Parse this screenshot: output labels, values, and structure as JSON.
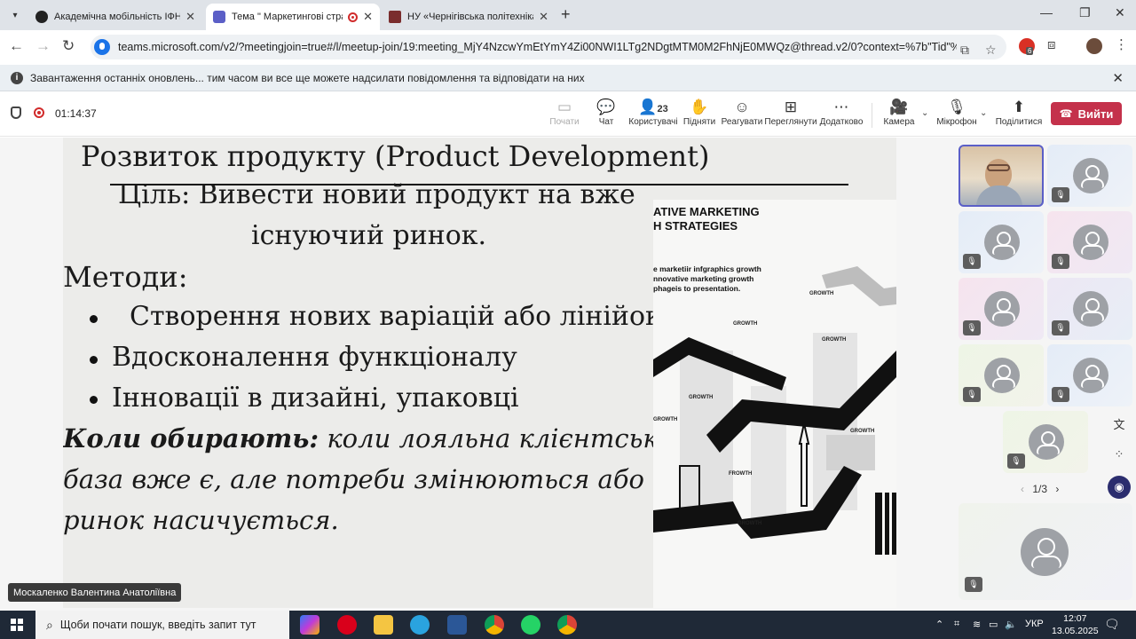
{
  "browser": {
    "tabs": [
      {
        "title": "Академічна мобільність ІФНТУ",
        "favicon": "github-icon",
        "active": false
      },
      {
        "title": "Тема \" Маркетингові страт",
        "favicon": "teams-icon",
        "active": true,
        "recording": true
      },
      {
        "title": "НУ «Чернігівська політехніка»",
        "favicon": "university-icon",
        "active": false
      }
    ],
    "new_tab": "+",
    "url": "teams.microsoft.com/v2/?meetingjoin=true#/l/meetup-join/19:meeting_MjY4NzcwYmEtYmY4Zi00NWI1LTg2NDgtMTM0M2FhNjE0MWQz@thread.v2/0?context=%7b\"Tid\"%3a\"33c71...",
    "profile_badge": "6"
  },
  "infobar": {
    "text": "Завантаження останніх оновлень... тим часом ви все ще можете надсилати повідомлення та відповідати на них"
  },
  "teams": {
    "timer": "01:14:37",
    "buttons": {
      "share": "Почати",
      "chat": "Чат",
      "people": "Користувачі",
      "people_count": "23",
      "raise": "Підняти",
      "react": "Реагувати",
      "view": "Переглянути",
      "more": "Додатково",
      "camera": "Камера",
      "mic": "Мікрофон",
      "share_screen": "Поділитися"
    },
    "leave": "Вийти",
    "accent_color": "#c4314b"
  },
  "slide": {
    "title": "Розвиток продукту (Product Development)",
    "goal_line1": "Ціль: Вивести новий продукт на вже",
    "goal_line2": "існуючий ринок.",
    "methods_heading": "Методи:",
    "bullets": [
      "Створення нових варіацій або лінійок",
      "Вдосконалення функціоналу",
      "Інновації в дизайні, упаковці"
    ],
    "when_bold": "Коли обирають:",
    "when_line1": "коли лояльна клієнтська",
    "when_line2": "база вже є, але потреби змінюються або",
    "when_line3": "ринок насичується.",
    "infographic": {
      "title_line1": "ATIVE MARKETING",
      "title_line2": "H STRATEGIES",
      "sub_line1": "e marketiir infgraphics growth",
      "sub_line2": "nnovative marketing growth",
      "sub_line3": "phageis to presentation.",
      "labels": [
        "GROWTH",
        "GROWTH",
        "GROWTH",
        "GROWTH",
        "GROWTH",
        "GROWTH",
        "FROWTH",
        "GROWTH"
      ]
    }
  },
  "presenter_name": "Москаленко Валентина Анатоліївна",
  "gallery": {
    "pager": "1/3"
  },
  "taskbar": {
    "search_placeholder": "Щоби почати пошук, введіть запит тут",
    "language": "УКР",
    "time": "12:07",
    "date": "13.05.2025"
  }
}
